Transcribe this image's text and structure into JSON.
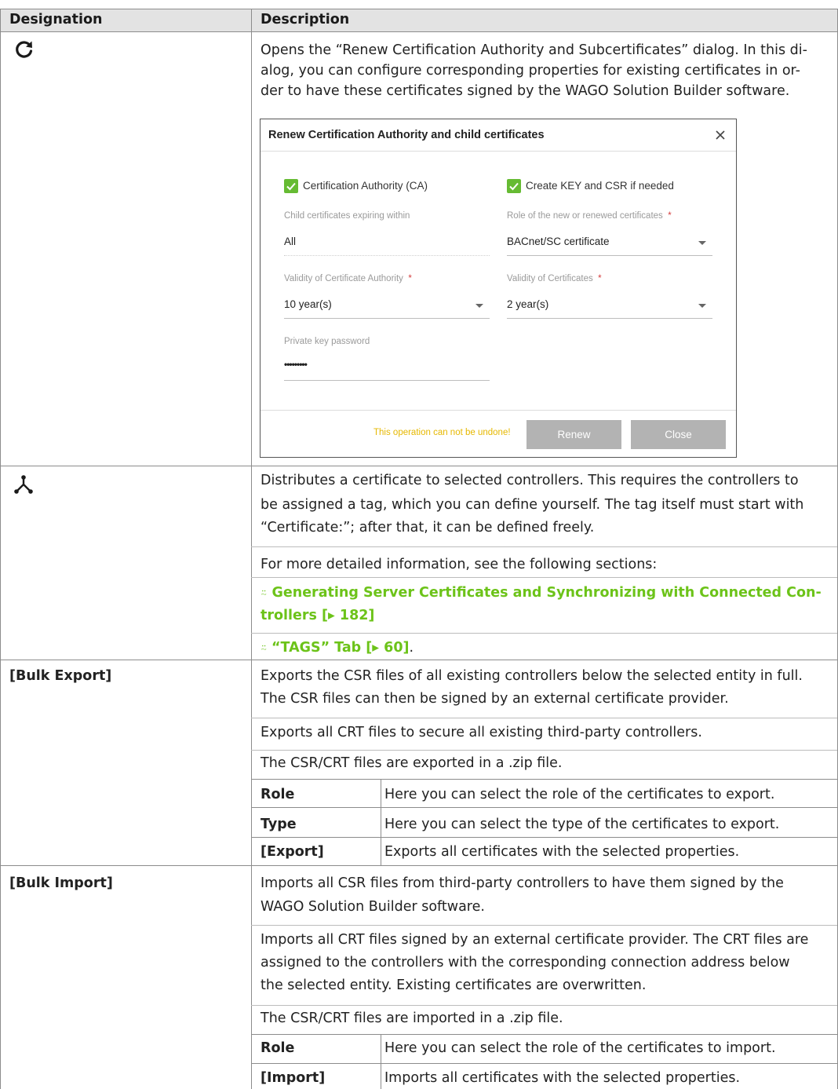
{
  "header": {
    "designation": "Designation",
    "description": "Description"
  },
  "row1": {
    "icon": "refresh-icon",
    "lines": [
      "Opens the “Renew Certification Authority and Subcertificates” dialog. In this di-",
      "alog, you can configure corresponding properties for existing certificates in or-",
      "der to have these certificates signed by the WAGO Solution Builder software."
    ],
    "dialog": {
      "title": "Renew Certification Authority and child certificates",
      "ca_checkbox": "Certification Authority (CA)",
      "key_checkbox": "Create KEY and CSR if needed",
      "child_label": "Child certificates expiring within",
      "child_value": "All",
      "role_label": "Role of the new or renewed certificates",
      "role_value": "BACnet/SC certificate",
      "validity_ca_label": "Validity of Certificate Authority",
      "validity_ca_value": "10 year(s)",
      "validity_cert_label": "Validity of Certificates",
      "validity_cert_value": "2 year(s)",
      "pk_label": "Private key password",
      "pk_value": "•••••••••",
      "required_mark": "*",
      "warning": "This operation can not be undone!",
      "renew_button": "Renew",
      "close_button": "Close"
    }
  },
  "row2": {
    "icon": "distribute-icon",
    "p1_lines": [
      "Distributes a certificate to selected controllers. This requires the controllers to",
      "be assigned a tag, which you can define yourself. The tag itself must start with",
      "“Certificate:”; after that, it can be defined freely."
    ],
    "p2": "For more detailed information, see the following sections:",
    "link1_line1": "Generating Server Certificates and Synchronizing with Connected Con-",
    "link1_line2": "trollers [▸ 182]",
    "link2": "“TAGS” Tab [▸ 60]",
    "link2_suffix": ".",
    "link_icon": "⍨"
  },
  "row3": {
    "designation": "[Bulk Export]",
    "p1_lines": [
      "Exports the CSR files of all existing controllers below the selected entity in full.",
      "The CSR files can then be signed by an external certificate provider."
    ],
    "p2": "Exports all CRT files to secure all existing third-party controllers.",
    "p3": "The CSR/CRT files are exported in a .zip file.",
    "sub": [
      {
        "term": "Role",
        "desc": "Here you can select the role of the certificates to export."
      },
      {
        "term": "Type",
        "desc": "Here you can select the type of the certificates to export."
      },
      {
        "term": "[Export]",
        "desc": "Exports all certificates with the selected properties."
      }
    ]
  },
  "row4": {
    "designation": "[Bulk Import]",
    "p1_lines": [
      "Imports all CSR files from third-party controllers to have them signed by the",
      "WAGO Solution Builder software."
    ],
    "p2_lines": [
      "Imports all CRT files signed by an external certificate provider. The CRT files are",
      "assigned to the controllers with the corresponding connection address below",
      "the selected entity. Existing certificates are overwritten."
    ],
    "p3": "The CSR/CRT files are imported in a .zip file.",
    "sub": [
      {
        "term": "Role",
        "desc": "Here you can select the role of the certificates to import."
      },
      {
        "term": "[Import]",
        "desc": "Imports all certificates with the selected properties."
      }
    ]
  }
}
